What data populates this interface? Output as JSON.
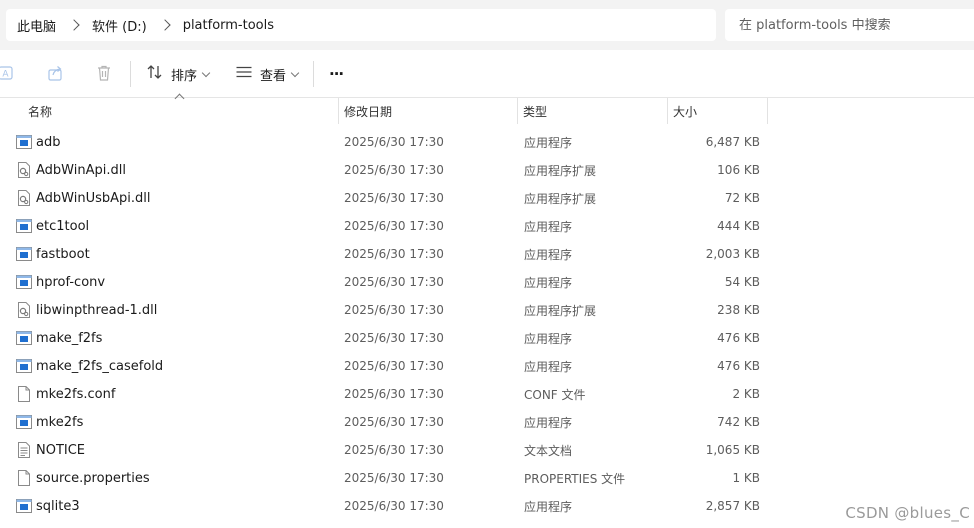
{
  "address": {
    "crumbs": [
      "此电脑",
      "软件 (D:)",
      "platform-tools"
    ],
    "search_placeholder": "在 platform-tools 中搜索"
  },
  "toolbar": {
    "sort_label": "排序",
    "view_label": "查看",
    "more_label": "···"
  },
  "columns": {
    "name": "名称",
    "date": "修改日期",
    "type": "类型",
    "size": "大小"
  },
  "files": [
    {
      "name": "adb",
      "date": "2025/6/30 17:30",
      "type": "应用程序",
      "size": "6,487 KB",
      "icon": "exe-icon"
    },
    {
      "name": "AdbWinApi.dll",
      "date": "2025/6/30 17:30",
      "type": "应用程序扩展",
      "size": "106 KB",
      "icon": "dll-icon"
    },
    {
      "name": "AdbWinUsbApi.dll",
      "date": "2025/6/30 17:30",
      "type": "应用程序扩展",
      "size": "72 KB",
      "icon": "dll-icon"
    },
    {
      "name": "etc1tool",
      "date": "2025/6/30 17:30",
      "type": "应用程序",
      "size": "444 KB",
      "icon": "exe-icon"
    },
    {
      "name": "fastboot",
      "date": "2025/6/30 17:30",
      "type": "应用程序",
      "size": "2,003 KB",
      "icon": "exe-icon"
    },
    {
      "name": "hprof-conv",
      "date": "2025/6/30 17:30",
      "type": "应用程序",
      "size": "54 KB",
      "icon": "exe-icon"
    },
    {
      "name": "libwinpthread-1.dll",
      "date": "2025/6/30 17:30",
      "type": "应用程序扩展",
      "size": "238 KB",
      "icon": "dll-icon"
    },
    {
      "name": "make_f2fs",
      "date": "2025/6/30 17:30",
      "type": "应用程序",
      "size": "476 KB",
      "icon": "exe-icon"
    },
    {
      "name": "make_f2fs_casefold",
      "date": "2025/6/30 17:30",
      "type": "应用程序",
      "size": "476 KB",
      "icon": "exe-icon"
    },
    {
      "name": "mke2fs.conf",
      "date": "2025/6/30 17:30",
      "type": "CONF 文件",
      "size": "2 KB",
      "icon": "file-icon"
    },
    {
      "name": "mke2fs",
      "date": "2025/6/30 17:30",
      "type": "应用程序",
      "size": "742 KB",
      "icon": "exe-icon"
    },
    {
      "name": "NOTICE",
      "date": "2025/6/30 17:30",
      "type": "文本文档",
      "size": "1,065 KB",
      "icon": "text-icon"
    },
    {
      "name": "source.properties",
      "date": "2025/6/30 17:30",
      "type": "PROPERTIES 文件",
      "size": "1 KB",
      "icon": "file-icon"
    },
    {
      "name": "sqlite3",
      "date": "2025/6/30 17:30",
      "type": "应用程序",
      "size": "2,857 KB",
      "icon": "exe-icon"
    }
  ],
  "watermark": "CSDN @blues_C",
  "colors": {
    "exe_icon_blue": "#1f6fd0",
    "chrome_bg": "#f3f3f3"
  }
}
